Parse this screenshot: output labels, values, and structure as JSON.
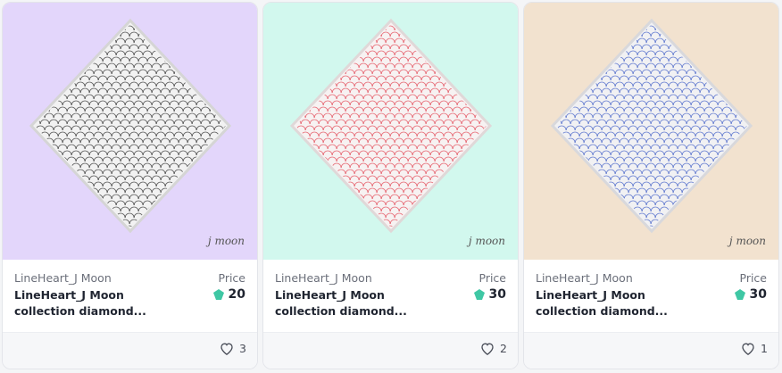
{
  "cards": [
    {
      "background": "#e3d6fb",
      "pattern_color": "#2a2a2a",
      "creator": "LineHeart_J Moon",
      "title": "LineHeart_J Moon collection diamond...",
      "price_label": "Price",
      "price": "20",
      "likes": "3",
      "signature": "j moon",
      "icons": {
        "currency": "gem-icon",
        "like": "heart-icon"
      }
    },
    {
      "background": "#d2f8ee",
      "pattern_color": "#e2404f",
      "creator": "LineHeart_J Moon",
      "title": "LineHeart_J Moon collection diamond...",
      "price_label": "Price",
      "price": "30",
      "likes": "2",
      "signature": "j moon",
      "icons": {
        "currency": "gem-icon",
        "like": "heart-icon"
      }
    },
    {
      "background": "#f2e2cf",
      "pattern_color": "#3c5bc6",
      "creator": "LineHeart_J Moon",
      "title": "LineHeart_J Moon collection diamond...",
      "price_label": "Price",
      "price": "30",
      "likes": "1",
      "signature": "j moon",
      "icons": {
        "currency": "gem-icon",
        "like": "heart-icon"
      }
    }
  ],
  "gem_color": "#3fc7a4"
}
